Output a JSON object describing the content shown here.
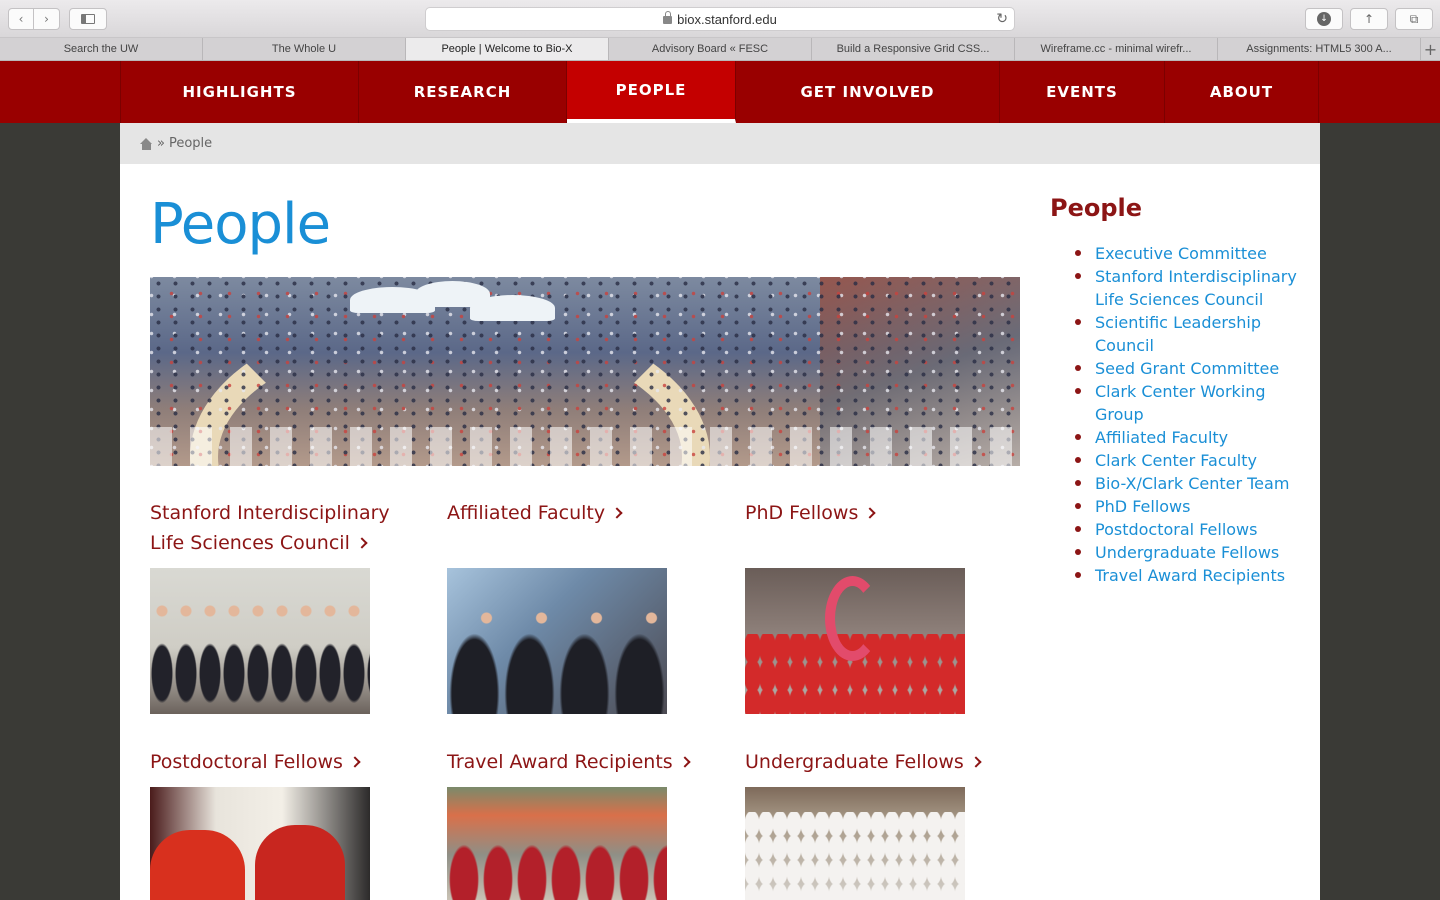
{
  "browser": {
    "url": "biox.stanford.edu",
    "tabs": [
      {
        "label": "Search the UW"
      },
      {
        "label": "The Whole U"
      },
      {
        "label": "People | Welcome to Bio-X"
      },
      {
        "label": "Advisory Board « FESC"
      },
      {
        "label": "Build a Responsive Grid CSS..."
      },
      {
        "label": "Wireframe.cc - minimal wirefr..."
      },
      {
        "label": "Assignments: HTML5 300 A..."
      }
    ],
    "active_tab": 2
  },
  "site_nav": {
    "items": [
      {
        "label": "HIGHLIGHTS"
      },
      {
        "label": "RESEARCH"
      },
      {
        "label": "PEOPLE"
      },
      {
        "label": "GET INVOLVED"
      },
      {
        "label": "EVENTS"
      },
      {
        "label": "ABOUT"
      }
    ],
    "active": "PEOPLE"
  },
  "breadcrumb": {
    "separator": "»",
    "current": "People"
  },
  "page": {
    "title": "People"
  },
  "grid": [
    {
      "label": "Stanford Interdisciplinary Life Sciences Council"
    },
    {
      "label": "Affiliated Faculty"
    },
    {
      "label": "PhD Fellows"
    },
    {
      "label": "Postdoctoral Fellows"
    },
    {
      "label": "Travel Award Recipients"
    },
    {
      "label": "Undergraduate Fellows"
    }
  ],
  "sidebar": {
    "title": "People",
    "items": [
      {
        "label": "Executive Committee"
      },
      {
        "label": "Stanford Interdisciplinary Life Sciences Council"
      },
      {
        "label": "Scientific Leadership Council"
      },
      {
        "label": "Seed Grant Committee"
      },
      {
        "label": "Clark Center Working Group"
      },
      {
        "label": "Affiliated Faculty"
      },
      {
        "label": "Clark Center Faculty"
      },
      {
        "label": "Bio-X/Clark Center Team"
      },
      {
        "label": "PhD Fellows"
      },
      {
        "label": "Postdoctoral Fellows"
      },
      {
        "label": "Undergraduate Fellows"
      },
      {
        "label": "Travel Award Recipients"
      }
    ]
  },
  "colors": {
    "brand_red": "#990000",
    "nav_active": "#c40000",
    "cardinal_text": "#8c1515",
    "link_blue": "#1a8fd6"
  }
}
